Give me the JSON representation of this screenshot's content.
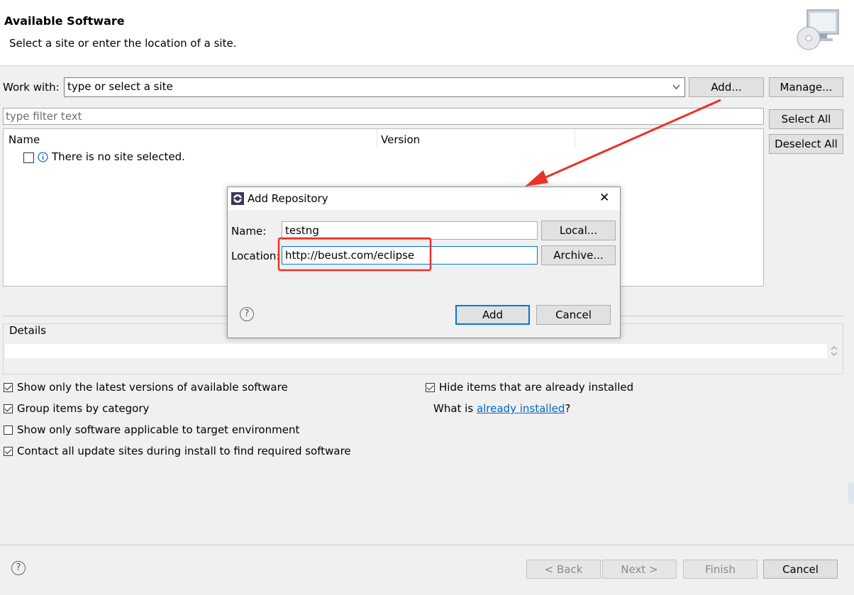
{
  "header": {
    "title": "Available Software",
    "subtitle": "Select a site or enter the location of a site."
  },
  "work_with": {
    "label": "Work with:",
    "placeholder": "type or select a site",
    "add_label": "Add...",
    "manage_label": "Manage..."
  },
  "filter": {
    "placeholder": "type filter text"
  },
  "side_buttons": {
    "select_all": "Select All",
    "deselect_all": "Deselect All"
  },
  "table": {
    "columns": [
      "Name",
      "Version"
    ],
    "empty_message": "There is no site selected."
  },
  "details": {
    "label": "Details"
  },
  "options": {
    "latest_versions": {
      "label": "Show only the latest versions of available software",
      "checked": true
    },
    "group_by_category": {
      "label": "Group items by category",
      "checked": true
    },
    "target_env": {
      "label": "Show only software applicable to target environment",
      "checked": false
    },
    "contact_sites": {
      "label": "Contact all update sites during install to find required software",
      "checked": true
    },
    "hide_installed": {
      "label": "Hide items that are already installed",
      "checked": true
    },
    "what_is_prefix": "What is ",
    "what_is_link": "already installed",
    "what_is_suffix": "?"
  },
  "dialog": {
    "title": "Add Repository",
    "name_label": "Name:",
    "name_value": "testng",
    "location_label": "Location:",
    "location_value": "http://beust.com/eclipse",
    "local_button": "Local...",
    "archive_button": "Archive...",
    "add_button": "Add",
    "cancel_button": "Cancel",
    "close_glyph": "✕",
    "help_glyph": "?"
  },
  "footer": {
    "help_glyph": "?",
    "back": "< Back",
    "next": "Next >",
    "finish": "Finish",
    "cancel": "Cancel"
  },
  "colors": {
    "annotation_red": "#e8322a",
    "link_blue": "#0066cc",
    "focus_blue": "#0078d7"
  }
}
